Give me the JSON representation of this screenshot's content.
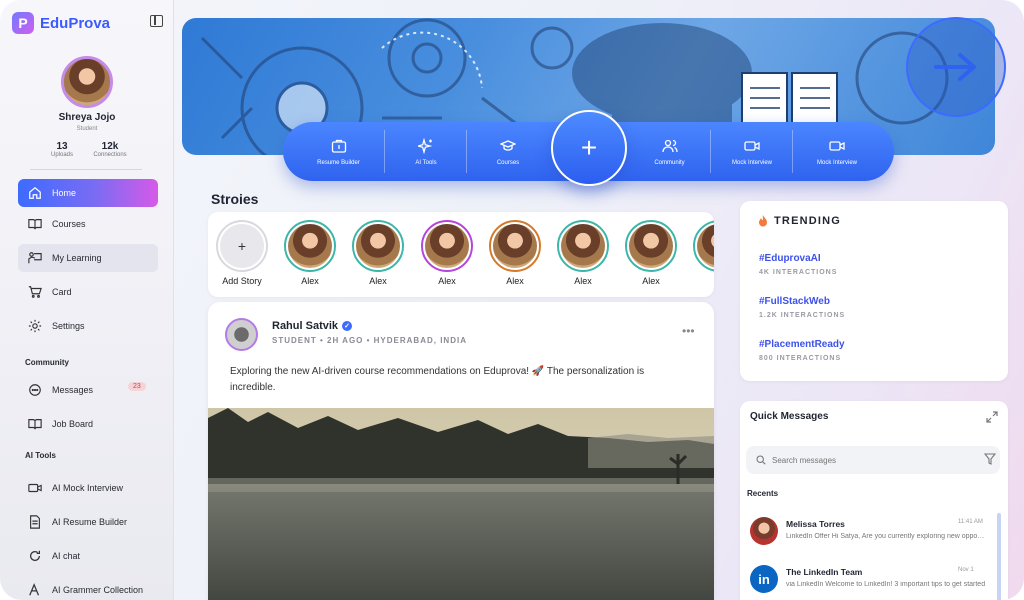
{
  "app": {
    "name": "EduProva",
    "accent": "#3d6bff",
    "gradient_end": "#d65ae8"
  },
  "profile": {
    "name": "Shreya Jojo",
    "role": "Student",
    "uploads": "13",
    "uploads_label": "Uploads",
    "connections": "12k",
    "connections_label": "Connections"
  },
  "nav": {
    "home": "Home",
    "courses": "Courses",
    "my_learning": "My Learning",
    "card": "Card",
    "settings": "Settings",
    "community_title": "Community",
    "messages": "Messages",
    "messages_badge": "23",
    "job_board": "Job Board",
    "ai_tools_title": "AI Tools",
    "ai_mock_interview": "AI Mock Interview",
    "ai_resume_builder": "AI Resume Builder",
    "ai_chat": "AI chat",
    "ai_grammer": "AI Grammer Collection"
  },
  "actions": [
    {
      "label": "Resume Builder",
      "icon": "briefcase-icon"
    },
    {
      "label": "AI Tools",
      "icon": "sparkles-icon"
    },
    {
      "label": "Courses",
      "icon": "graduation-cap-icon"
    },
    {
      "label": "Community",
      "icon": "users-icon"
    },
    {
      "label": "Mock Interview",
      "icon": "video-icon"
    },
    {
      "label": "Mock Interview",
      "icon": "video-icon"
    }
  ],
  "plus": "+",
  "stories": {
    "title": "Stroies",
    "add_label": "Add Story",
    "add_plus": "+",
    "items": [
      {
        "name": "Alex",
        "ring": "#3cb6a8"
      },
      {
        "name": "Alex",
        "ring": "#3cb6a8"
      },
      {
        "name": "Alex",
        "ring": "#b545d9"
      },
      {
        "name": "Alex",
        "ring": "#d47a2c"
      },
      {
        "name": "Alex",
        "ring": "#3cb6a8"
      },
      {
        "name": "Alex",
        "ring": "#3cb6a8"
      },
      {
        "name": "A",
        "ring": "#3cb6a8"
      }
    ]
  },
  "post": {
    "author": "Rahul Satvik",
    "verified": "✓",
    "meta": "STUDENT • 2H AGO • HYDERABAD, INDIA",
    "more": "•••",
    "text": "Exploring the new AI-driven course recommendations on Eduprova! 🚀 The personalization is incredible."
  },
  "trending": {
    "title": "TRENDING",
    "items": [
      {
        "tag": "#EduprovaAI",
        "sub": "4K INTERACTIONS"
      },
      {
        "tag": "#FullStackWeb",
        "sub": "1.2K INTERACTIONS"
      },
      {
        "tag": "#PlacementReady",
        "sub": "800 INTERACTIONS"
      }
    ]
  },
  "quick_messages": {
    "title": "Quick Messages",
    "search_placeholder": "Search messages",
    "recents": "Recents",
    "items": [
      {
        "name": "Melissa Torres",
        "time": "11:41 AM",
        "preview": "LinkedIn Offer Hi Satya, Are you currently exploring new opportunities?"
      },
      {
        "name": "The LinkedIn Team",
        "time": "Nov 1",
        "preview": "via LinkedIn Welcome to LinkedIn! 3 important tips to get started"
      }
    ]
  }
}
